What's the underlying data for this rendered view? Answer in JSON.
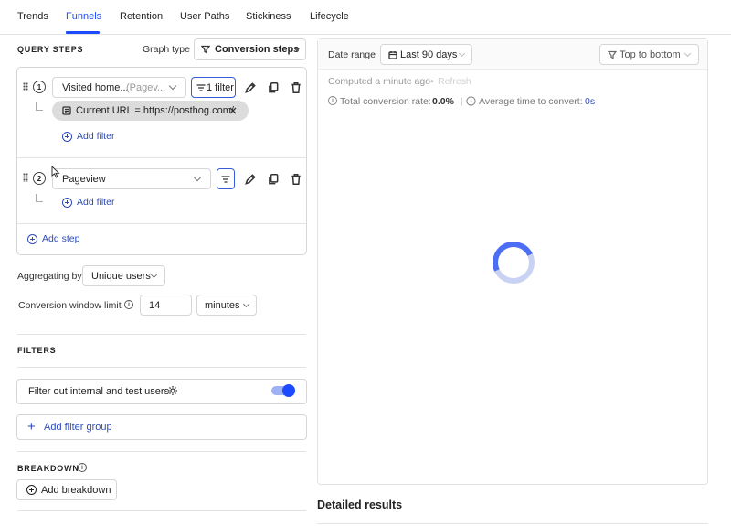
{
  "tabs": [
    {
      "label": "Trends",
      "active": false
    },
    {
      "label": "Funnels",
      "active": true
    },
    {
      "label": "Retention",
      "active": false
    },
    {
      "label": "User Paths",
      "active": false
    },
    {
      "label": "Stickiness",
      "active": false
    },
    {
      "label": "Lifecycle",
      "active": false
    }
  ],
  "query_steps": {
    "title": "QUERY STEPS",
    "graph_type_label": "Graph type",
    "graph_type_value": "Conversion steps",
    "steps": [
      {
        "number": "1",
        "event": "Visited home...",
        "event_sub": "(Pagev...",
        "filter_badge": "1 filter",
        "filter": "Current URL = https://posthog.com/",
        "add_filter": "Add filter"
      },
      {
        "number": "2",
        "event": "Pageview",
        "add_filter": "Add filter"
      }
    ],
    "add_step": "Add step"
  },
  "aggregating": {
    "label": "Aggregating by",
    "value": "Unique users"
  },
  "conversion_window": {
    "label": "Conversion window limit",
    "value": "14",
    "unit": "minutes"
  },
  "filters": {
    "title": "FILTERS",
    "internal_toggle_label": "Filter out internal and test users",
    "internal_toggle_on": true,
    "add_filter_group": "Add filter group"
  },
  "breakdown": {
    "title": "BREAKDOWN",
    "add_label": "Add breakdown"
  },
  "results": {
    "date_range_label": "Date range",
    "date_range_value": "Last 90 days",
    "order_value": "Top to bottom",
    "computed": "Computed a minute ago",
    "refresh": "Refresh",
    "total_rate_label": "Total conversion rate:",
    "total_rate_value": "0.0%",
    "avg_time_label": "Average time to convert:",
    "avg_time_value": "0s",
    "detailed_title": "Detailed results"
  },
  "colors": {
    "accent": "#1d4aff",
    "link": "#2e4bb8",
    "spinner": "#4c6ef5"
  }
}
